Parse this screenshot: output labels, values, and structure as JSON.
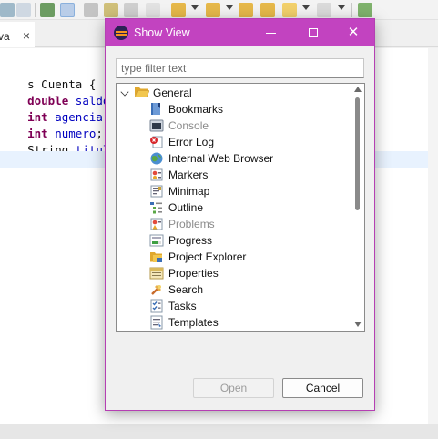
{
  "editor": {
    "tab_label": "va",
    "tab_close": "×",
    "code": [
      {
        "pre": "s ",
        "kw": "",
        "mid": "Cuenta {",
        "fld": ""
      },
      {
        "pre": "",
        "kw": "double",
        "mid": " ",
        "fld": "saldo",
        "post": ";"
      },
      {
        "pre": "",
        "kw": "int",
        "mid": " ",
        "fld": "agencia",
        "post": ";"
      },
      {
        "pre": "",
        "kw": "int",
        "mid": " ",
        "fld": "numero",
        "post": ";"
      },
      {
        "pre": "String ",
        "kw": "",
        "mid": "",
        "fld": "titular",
        "post": ";"
      }
    ]
  },
  "dialog": {
    "title": "Show View",
    "minimize_symbol": "",
    "maximize_symbol": "",
    "close_symbol": "✕",
    "filter_placeholder": "type filter text",
    "tree": {
      "category": "General",
      "items": [
        {
          "label": "Bookmarks",
          "icon": "bookmarks-icon",
          "enabled": true
        },
        {
          "label": "Console",
          "icon": "console-icon",
          "enabled": false
        },
        {
          "label": "Error Log",
          "icon": "error-log-icon",
          "enabled": true
        },
        {
          "label": "Internal Web Browser",
          "icon": "globe-icon",
          "enabled": true
        },
        {
          "label": "Markers",
          "icon": "markers-icon",
          "enabled": true
        },
        {
          "label": "Minimap",
          "icon": "minimap-icon",
          "enabled": true
        },
        {
          "label": "Outline",
          "icon": "outline-icon",
          "enabled": true
        },
        {
          "label": "Problems",
          "icon": "problems-icon",
          "enabled": false
        },
        {
          "label": "Progress",
          "icon": "progress-icon",
          "enabled": true
        },
        {
          "label": "Project Explorer",
          "icon": "project-explorer-icon",
          "enabled": true
        },
        {
          "label": "Properties",
          "icon": "properties-icon",
          "enabled": true
        },
        {
          "label": "Search",
          "icon": "search-icon",
          "enabled": true
        },
        {
          "label": "Tasks",
          "icon": "tasks-icon",
          "enabled": true
        },
        {
          "label": "Templates",
          "icon": "templates-icon",
          "enabled": true
        }
      ]
    },
    "open_label": "Open",
    "cancel_label": "Cancel"
  },
  "colors": {
    "title_bar": "#c243c0",
    "keyword": "#7f0055",
    "field": "#0000c0"
  }
}
